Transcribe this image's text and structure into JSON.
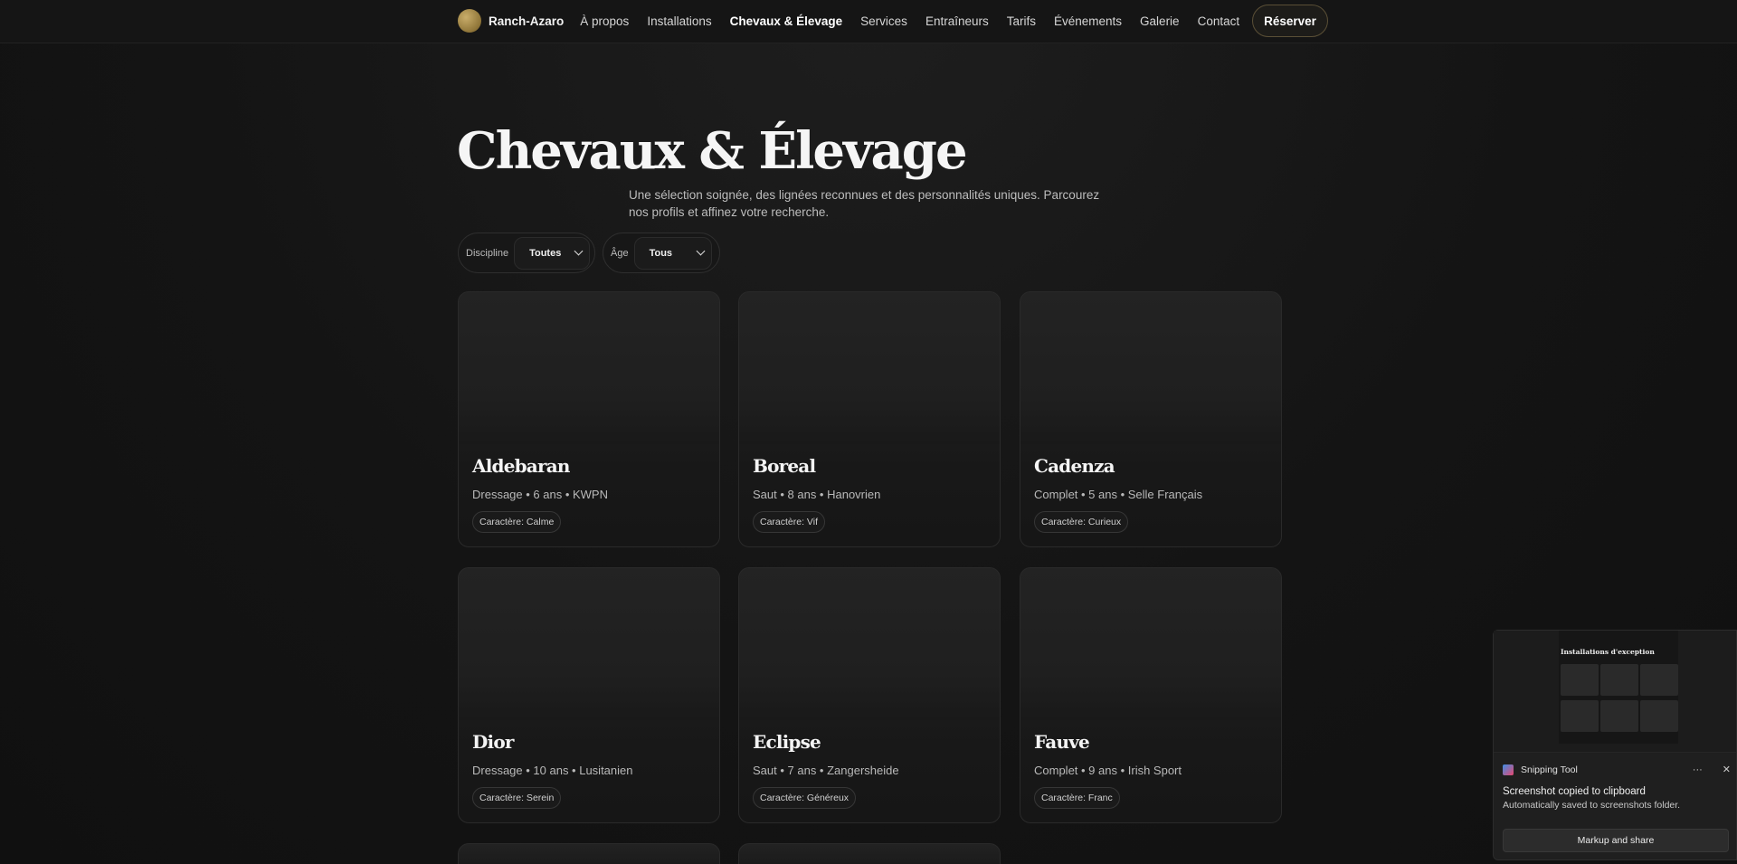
{
  "nav": {
    "brand": "Ranch-Azaro",
    "links": [
      "À propos",
      "Installations",
      "Chevaux & Élevage",
      "Services",
      "Entraîneurs",
      "Tarifs",
      "Événements",
      "Galerie",
      "Contact"
    ],
    "active": "Chevaux & Élevage",
    "cta": "Réserver"
  },
  "hero": {
    "title": "Chevaux & Élevage",
    "subtitle": "Une sélection soignée, des lignées reconnues et des personnalités uniques. Parcourez nos profils et affinez votre recherche."
  },
  "filters": {
    "discipline": {
      "label": "Discipline",
      "selected": "Toutes"
    },
    "age": {
      "label": "Âge",
      "selected": "Tous"
    }
  },
  "horses": [
    {
      "name": "Aldebaran",
      "meta": "Dressage • 6 ans • KWPN",
      "trait": "Caractère: Calme"
    },
    {
      "name": "Boreal",
      "meta": "Saut • 8 ans • Hanovrien",
      "trait": "Caractère: Vif"
    },
    {
      "name": "Cadenza",
      "meta": "Complet • 5 ans • Selle Français",
      "trait": "Caractère: Curieux"
    },
    {
      "name": "Dior",
      "meta": "Dressage • 10 ans • Lusitanien",
      "trait": "Caractère: Serein"
    },
    {
      "name": "Eclipse",
      "meta": "Saut • 7 ans • Zangersheide",
      "trait": "Caractère: Généreux"
    },
    {
      "name": "Fauve",
      "meta": "Complet • 9 ans • Irish Sport",
      "trait": "Caractère: Franc"
    }
  ],
  "toast": {
    "app": "Snipping Tool",
    "preview_title": "Installations d'exception",
    "title": "Screenshot copied to clipboard",
    "text": "Automatically saved to screenshots folder.",
    "button": "Markup and share",
    "more_icon": "more-icon",
    "close_icon": "close-icon"
  }
}
